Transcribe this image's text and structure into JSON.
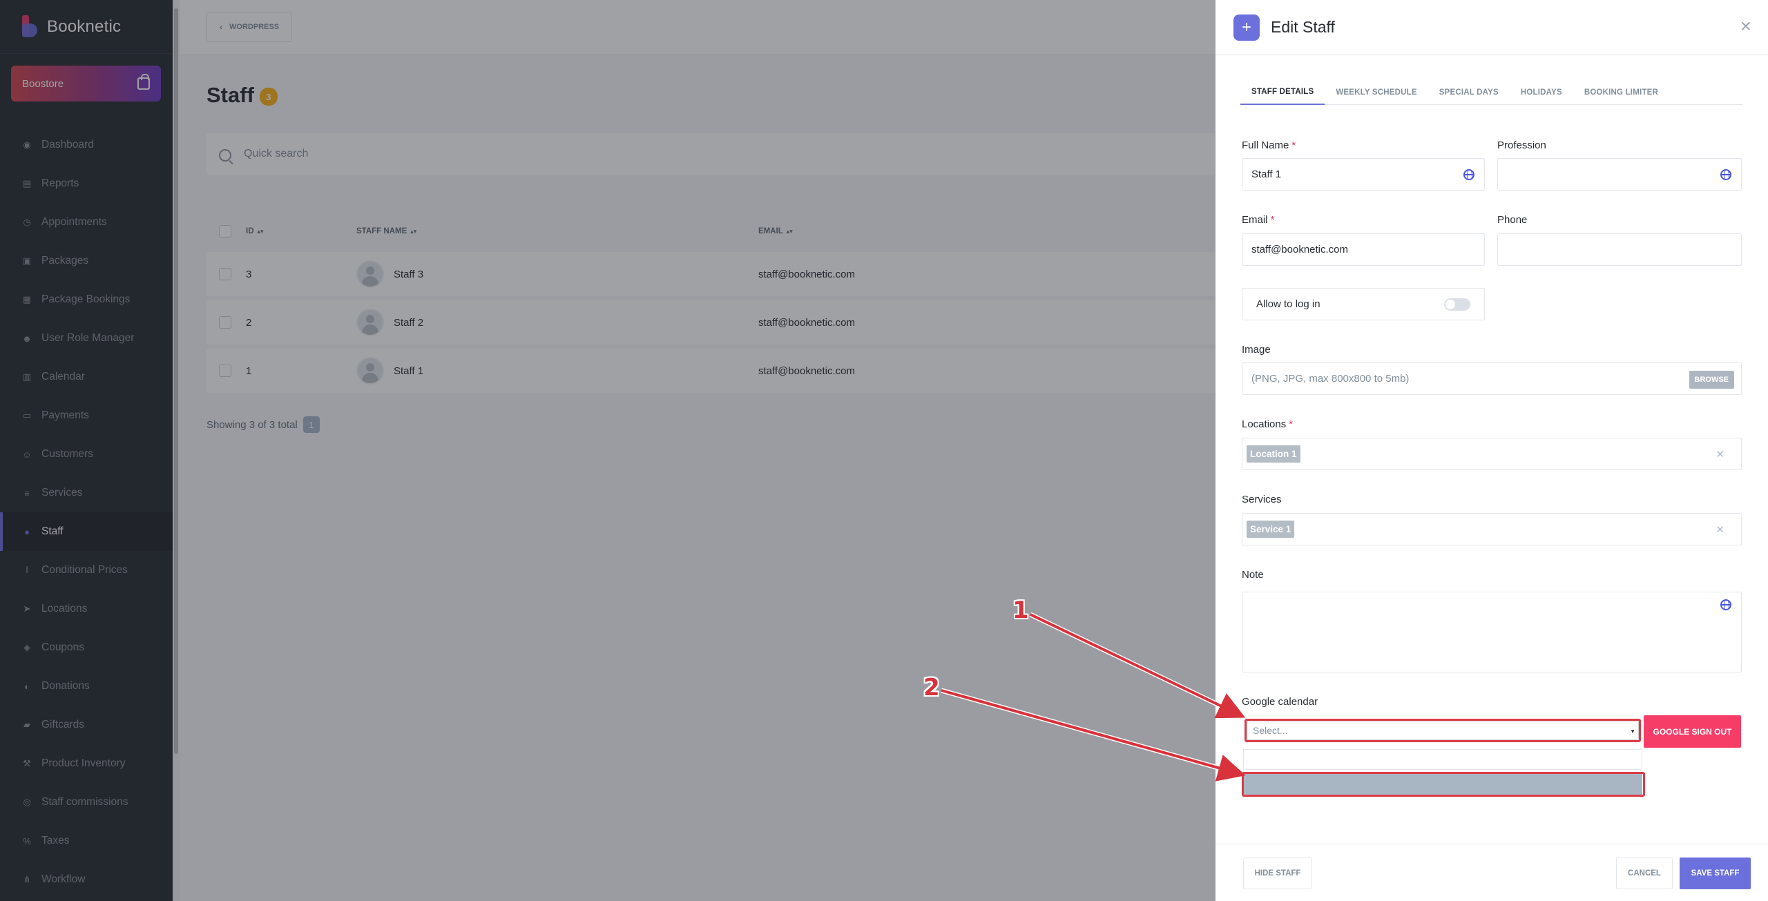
{
  "sidebar": {
    "brand": "Booknetic",
    "boostore": "Boostore",
    "items": [
      {
        "label": "Dashboard",
        "icon": "dashboard-icon"
      },
      {
        "label": "Reports",
        "icon": "reports-icon"
      },
      {
        "label": "Appointments",
        "icon": "appointments-icon"
      },
      {
        "label": "Packages",
        "icon": "packages-icon"
      },
      {
        "label": "Package Bookings",
        "icon": "package-bookings-icon"
      },
      {
        "label": "User Role Manager",
        "icon": "user-role-icon"
      },
      {
        "label": "Calendar",
        "icon": "calendar-icon"
      },
      {
        "label": "Payments",
        "icon": "payments-icon"
      },
      {
        "label": "Customers",
        "icon": "customers-icon"
      },
      {
        "label": "Services",
        "icon": "services-icon"
      },
      {
        "label": "Staff",
        "icon": "staff-icon",
        "active": true
      },
      {
        "label": "Conditional Prices",
        "icon": "conditional-prices-icon"
      },
      {
        "label": "Locations",
        "icon": "locations-icon"
      },
      {
        "label": "Coupons",
        "icon": "coupons-icon"
      },
      {
        "label": "Donations",
        "icon": "donations-icon"
      },
      {
        "label": "Giftcards",
        "icon": "giftcards-icon"
      },
      {
        "label": "Product Inventory",
        "icon": "product-inventory-icon"
      },
      {
        "label": "Staff commissions",
        "icon": "staff-commissions-icon"
      },
      {
        "label": "Taxes",
        "icon": "taxes-icon"
      },
      {
        "label": "Workflow",
        "icon": "workflow-icon"
      }
    ]
  },
  "topbar": {
    "wordpress": "WORDPRESS"
  },
  "page": {
    "title": "Staff",
    "count": "3",
    "search_placeholder": "Quick search",
    "columns": {
      "id": "ID",
      "name": "STAFF NAME",
      "email": "EMAIL"
    },
    "rows": [
      {
        "id": "3",
        "name": "Staff 3",
        "email": "staff@booknetic.com"
      },
      {
        "id": "2",
        "name": "Staff 2",
        "email": "staff@booknetic.com"
      },
      {
        "id": "1",
        "name": "Staff 1",
        "email": "staff@booknetic.com"
      }
    ],
    "showing": "Showing 3 of 3 total",
    "page_number": "1"
  },
  "drawer": {
    "title": "Edit Staff",
    "tabs": [
      "STAFF DETAILS",
      "WEEKLY SCHEDULE",
      "SPECIAL DAYS",
      "HOLIDAYS",
      "BOOKING LIMITER"
    ],
    "full_name_label": "Full Name",
    "full_name_value": "Staff 1",
    "profession_label": "Profession",
    "profession_value": "",
    "email_label": "Email",
    "email_value": "staff@booknetic.com",
    "phone_label": "Phone",
    "phone_value": "",
    "allow_login_label": "Allow to log in",
    "image_label": "Image",
    "image_placeholder": "(PNG, JPG, max 800x800 to 5mb)",
    "browse_label": "BROWSE",
    "locations_label": "Locations",
    "location_chip": "Location 1",
    "services_label": "Services",
    "service_chip": "Service 1",
    "note_label": "Note",
    "google_calendar_label": "Google calendar",
    "google_select_placeholder": "Select...",
    "google_signout": "GOOGLE SIGN OUT",
    "hide_staff": "HIDE STAFF",
    "cancel": "CANCEL",
    "save": "SAVE STAFF",
    "required_mark": "*"
  },
  "annotations": {
    "one": "1",
    "two": "2"
  },
  "colors": {
    "accent": "#6c70dc",
    "danger": "#f63d68",
    "annotation": "#d8323c",
    "sidebar_bg": "#292d32"
  }
}
